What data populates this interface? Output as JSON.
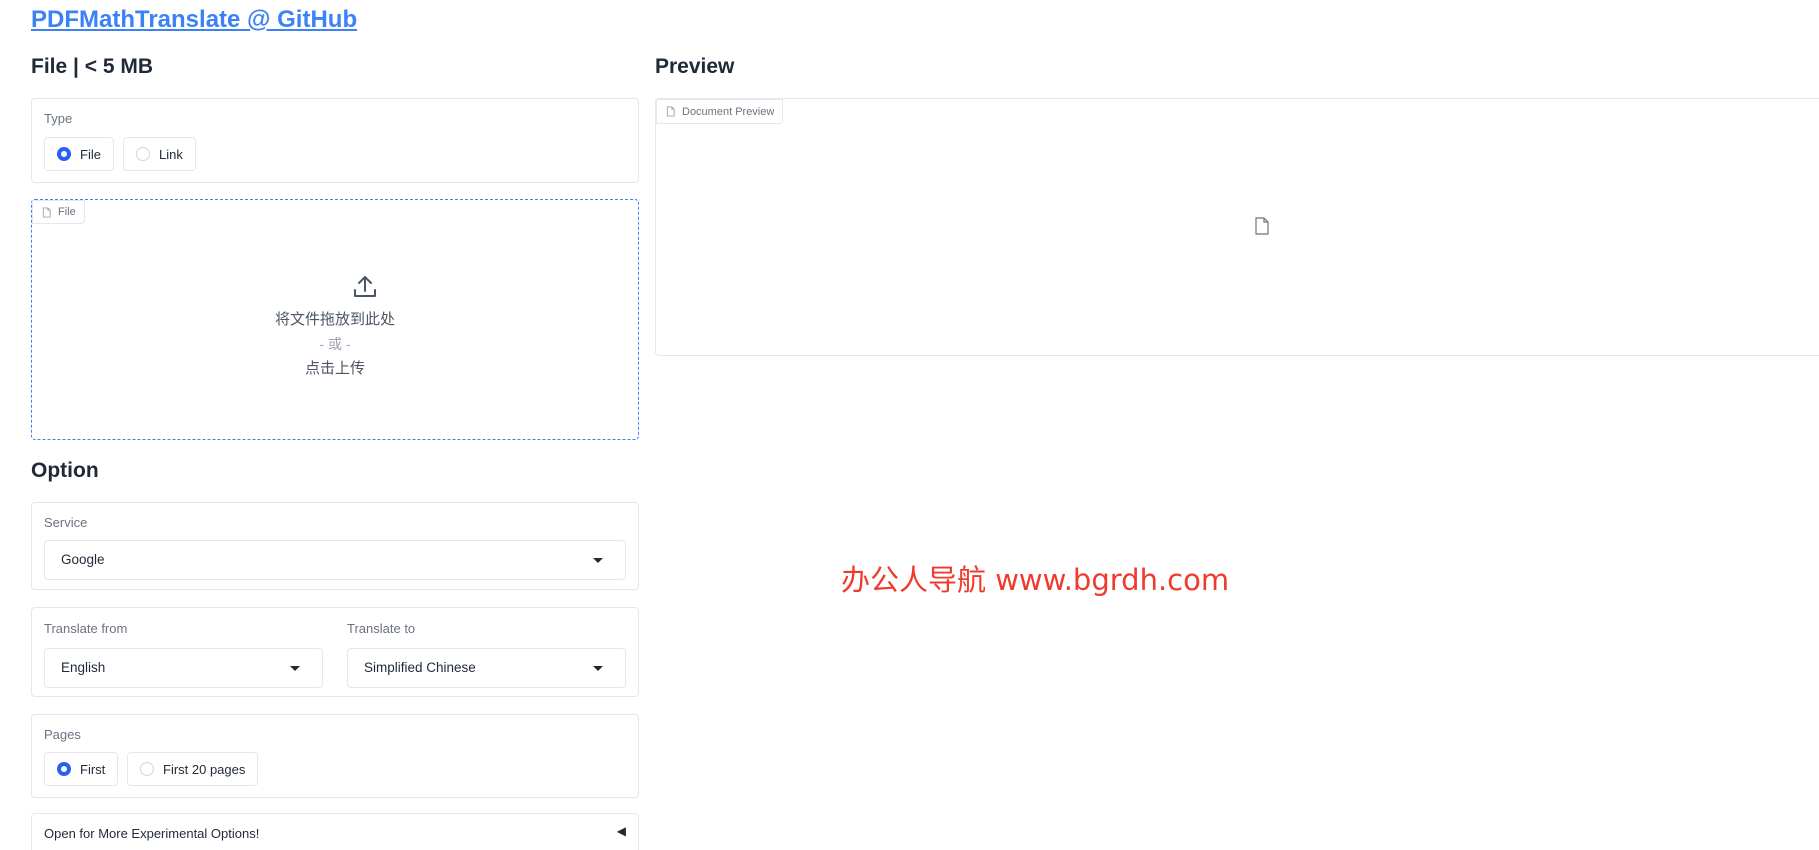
{
  "header": {
    "title_link": "PDFMathTranslate @ GitHub"
  },
  "file_section": {
    "heading": "File | < 5 MB",
    "type_label": "Type",
    "type_options": [
      {
        "label": "File",
        "checked": true
      },
      {
        "label": "Link",
        "checked": false
      }
    ],
    "dropzone": {
      "chip_label": "File",
      "drop_text": "将文件拖放到此处",
      "or_text": "- 或 -",
      "click_text": "点击上传"
    }
  },
  "option_section": {
    "heading": "Option",
    "service": {
      "label": "Service",
      "value": "Google"
    },
    "translate_from": {
      "label": "Translate from",
      "value": "English"
    },
    "translate_to": {
      "label": "Translate to",
      "value": "Simplified Chinese"
    },
    "pages": {
      "label": "Pages",
      "options": [
        {
          "label": "First",
          "checked": true
        },
        {
          "label": "First 20 pages",
          "checked": false
        }
      ]
    },
    "experimental_label": "Open for More Experimental Options!",
    "experimental_arrow": "◀"
  },
  "preview_section": {
    "heading": "Preview",
    "chip_label": "Document Preview"
  },
  "watermark": "办公人导航 www.bgrdh.com",
  "colors": {
    "accent": "#2563eb",
    "link": "#3b82f6",
    "border": "#e5e7eb",
    "watermark": "#ef3b2d"
  },
  "icons": [
    "file-icon",
    "upload-icon",
    "caret-down-icon",
    "document-icon"
  ]
}
